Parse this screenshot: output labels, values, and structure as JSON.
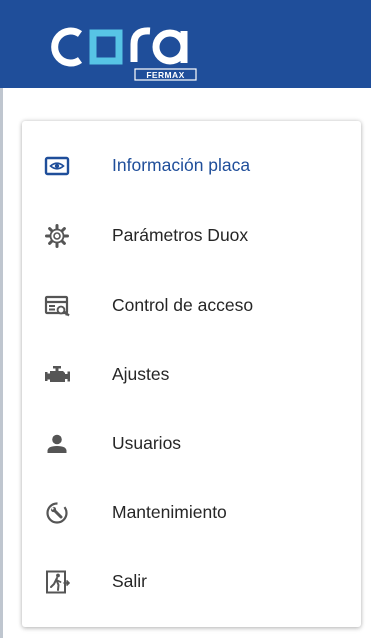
{
  "header": {
    "brand": "cora",
    "sub_brand": "FERMAX"
  },
  "colors": {
    "header_bg": "#1f4e9a",
    "active": "#1f4e9a",
    "icon": "#555555",
    "text": "#262626"
  },
  "menu": {
    "items": [
      {
        "label": "Información placa",
        "icon": "panel-eye-icon",
        "active": true
      },
      {
        "label": "Parámetros Duox",
        "icon": "gear-icon"
      },
      {
        "label": "Control de acceso",
        "icon": "access-card-icon"
      },
      {
        "label": "Ajustes",
        "icon": "engine-icon"
      },
      {
        "label": "Usuarios",
        "icon": "person-icon"
      },
      {
        "label": "Mantenimiento",
        "icon": "wrench-clock-icon"
      },
      {
        "label": "Salir",
        "icon": "exit-door-icon"
      }
    ]
  }
}
